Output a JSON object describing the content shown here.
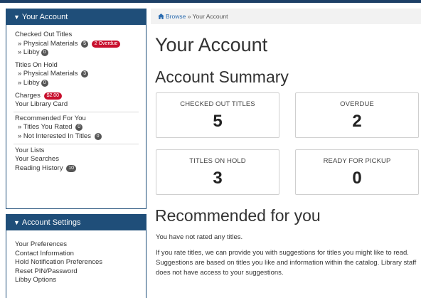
{
  "sidebar": {
    "account_title": "Your Account",
    "checked_out_titles": "Checked Out Titles",
    "physical_materials": "» Physical Materials",
    "physical_materials_count": "5",
    "overdue_badge": "2 Overdue",
    "libby": "» Libby",
    "libby_count": "0",
    "titles_on_hold": "Titles On Hold",
    "hold_physical_materials": "» Physical Materials",
    "hold_physical_count": "3",
    "hold_libby": "» Libby",
    "hold_libby_count": "0",
    "charges": "Charges",
    "charges_amount": "$2.00",
    "library_card": "Your Library Card",
    "recommended_for_you": "Recommended For You",
    "titles_you_rated": "» Titles You Rated",
    "titles_you_rated_count": "0",
    "not_interested": "» Not Interested In Titles",
    "not_interested_count": "0",
    "your_lists": "Your Lists",
    "your_searches": "Your Searches",
    "reading_history": "Reading History",
    "reading_history_count": "10",
    "settings_title": "Account Settings",
    "settings_items": [
      "Your Preferences",
      "Contact Information",
      "Hold Notification Preferences",
      "Reset PIN/Password",
      "Libby Options"
    ]
  },
  "breadcrumb": {
    "home": "Browse",
    "current": "» Your Account"
  },
  "main": {
    "title": "Your Account",
    "summary_title": "Account Summary",
    "cards": [
      {
        "label": "CHECKED OUT TITLES",
        "value": "5"
      },
      {
        "label": "OVERDUE",
        "value": "2"
      },
      {
        "label": "TITLES ON HOLD",
        "value": "3"
      },
      {
        "label": "READY FOR PICKUP",
        "value": "0"
      }
    ],
    "recommended_title": "Recommended for you",
    "not_rated_text": "You have not rated any titles.",
    "rate_info": "If you rate titles, we can provide you with suggestions for titles you might like to read. Suggestions are based on titles you like and information within the catalog. Library staff does not have access to your suggestions."
  },
  "colors": {
    "panel_header": "#1f4e79",
    "badge_red": "#c8102e",
    "badge_gray": "#555555",
    "link_blue": "#2b6cb0"
  },
  "icons": {
    "panel_toggle": "chevron-down-icon",
    "breadcrumb_home": "home-icon"
  }
}
